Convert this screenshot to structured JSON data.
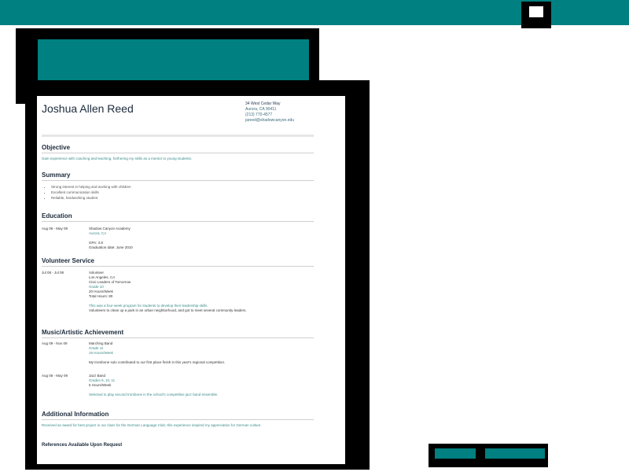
{
  "resume": {
    "name": "Joshua Allen Reed",
    "contact": {
      "line1": "34 West Cedar Way",
      "line2": "Aurora, CA 90411",
      "line3": "(213) 770-4577",
      "line4": "jareed@shadowcanyon.edu"
    },
    "sections": {
      "objective": {
        "heading": "Objective",
        "text": "Gain experience with coaching and teaching, furthering my skills as a mentor to young students."
      },
      "summary": {
        "heading": "Summary",
        "items": [
          "Strong interest in helping and working with children",
          "Excellent communication skills",
          "Reliable, hardworking student"
        ]
      },
      "education": {
        "heading": "Education",
        "date": "Aug 06 - May 09",
        "school": "Shadow Canyon Academy",
        "location": "Aurora, CA",
        "gpa": "GPA: 3.8",
        "graduation": "Graduation date: June 2010"
      },
      "volunteer": {
        "heading": "Volunteer Service",
        "date": "Jul 08 - Jul 08",
        "role": "Volunteer",
        "location": "Los Angeles, CA",
        "org": "Civic Leaders of Tomorrow",
        "grade": "Grade 10",
        "hours_week": "20 Hours/Week",
        "total_hours": "Total Hours: 80",
        "desc1": "This was a four-week program for students to develop their leadership skills.",
        "desc2": "Volunteers to clean up a park in an urban neighborhood, and got to meet several community leaders."
      },
      "music": {
        "heading": "Music/Artistic Achievement",
        "entry1": {
          "date": "Aug 09 - Nov 09",
          "title": "Marching Band",
          "grade": "Grade 11",
          "hours": "15 Hours/Week",
          "desc": "My trombone solo contributed to our first place finish in this year's regional competition."
        },
        "entry2": {
          "date": "Aug 06 - May 09",
          "title": "Jazz Band",
          "grade": "Grades 9, 10, 11",
          "hours": "5 Hours/Week",
          "desc": "Selected to play second trombone in the school's competitive jazz band ensemble."
        }
      },
      "additional": {
        "heading": "Additional Information",
        "text": "Received an award for best project in our class for the German Language Club; this experience inspired my appreciation for German culture."
      },
      "references": {
        "heading": "References Available Upon Request"
      }
    }
  }
}
